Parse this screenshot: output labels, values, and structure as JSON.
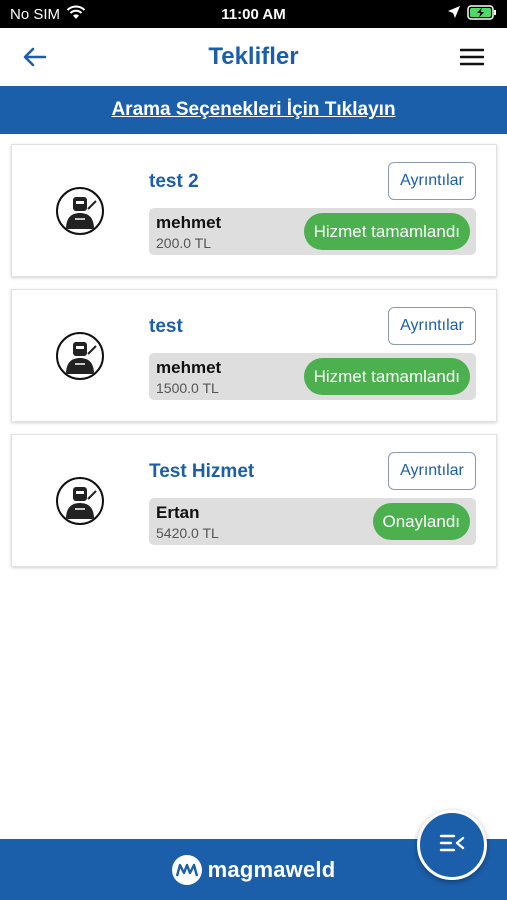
{
  "status_bar": {
    "carrier": "No SIM",
    "time": "11:00 AM",
    "icons": [
      "wifi-icon",
      "location-arrow-icon",
      "battery-charging-icon"
    ]
  },
  "nav": {
    "title": "Teklifler",
    "back_icon": "arrow-left-icon",
    "menu_icon": "hamburger-menu-icon"
  },
  "search_banner": {
    "label": "Arama Seçenekleri İçin Tıklayın"
  },
  "offers": [
    {
      "title": "test 2",
      "details_label": "Ayrıntılar",
      "name": "mehmet",
      "price": "200.0 TL",
      "status": "Hizmet tamamlandı"
    },
    {
      "title": "test",
      "details_label": "Ayrıntılar",
      "name": "mehmet",
      "price": "1500.0 TL",
      "status": "Hizmet tamamlandı"
    },
    {
      "title": "Test Hizmet",
      "details_label": "Ayrıntılar",
      "name": "Ertan",
      "price": "5420.0 TL",
      "status": "Onaylandı"
    }
  ],
  "footer": {
    "brand": "magmaweld",
    "logo_icon": "magmaweld-logo-icon"
  },
  "fab": {
    "icon": "collapse-menu-icon"
  },
  "colors": {
    "primary": "#1b5fab",
    "status_green": "#4cb04f",
    "info_bg": "#dedede"
  }
}
